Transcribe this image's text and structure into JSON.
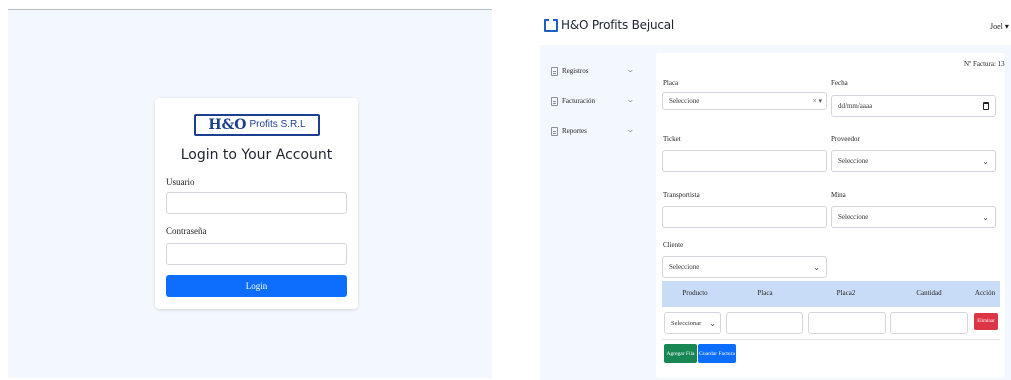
{
  "login": {
    "logo_main": "H&O",
    "logo_sub": "Profits S.R.L",
    "title": "Login to Your Account",
    "usuario_label": "Usuario",
    "contrasena_label": "Contraseña",
    "login_button": "Login"
  },
  "app": {
    "brand": "H&O Profits Bejucal",
    "user": "Joel ▾",
    "sidebar": [
      {
        "label": "Registros"
      },
      {
        "label": "Facturación"
      },
      {
        "label": "Reportes"
      }
    ],
    "invoice_number": "Nº Factura: 13",
    "form": {
      "placa_label": "Placa",
      "placa_value": "Seleccione",
      "placa_clear": "× ▾",
      "fecha_label": "Fecha",
      "fecha_value": "dd/mm/aaaa",
      "ticket_label": "Ticket",
      "proveedor_label": "Proveedor",
      "proveedor_value": "Seleccione",
      "transportista_label": "Transportista",
      "mina_label": "Mina",
      "mina_value": "Seleccione",
      "cliente_label": "Cliente",
      "cliente_value": "Seleccione"
    },
    "table": {
      "headers": [
        "Producto",
        "Placa",
        "Placa2",
        "Cantidad",
        "Acción"
      ],
      "row": {
        "producto_value": "Seleccionar",
        "delete_button": "Eliminar"
      }
    },
    "buttons": {
      "add_row": "Agregar Fila",
      "save": "Guardar Factura"
    }
  }
}
